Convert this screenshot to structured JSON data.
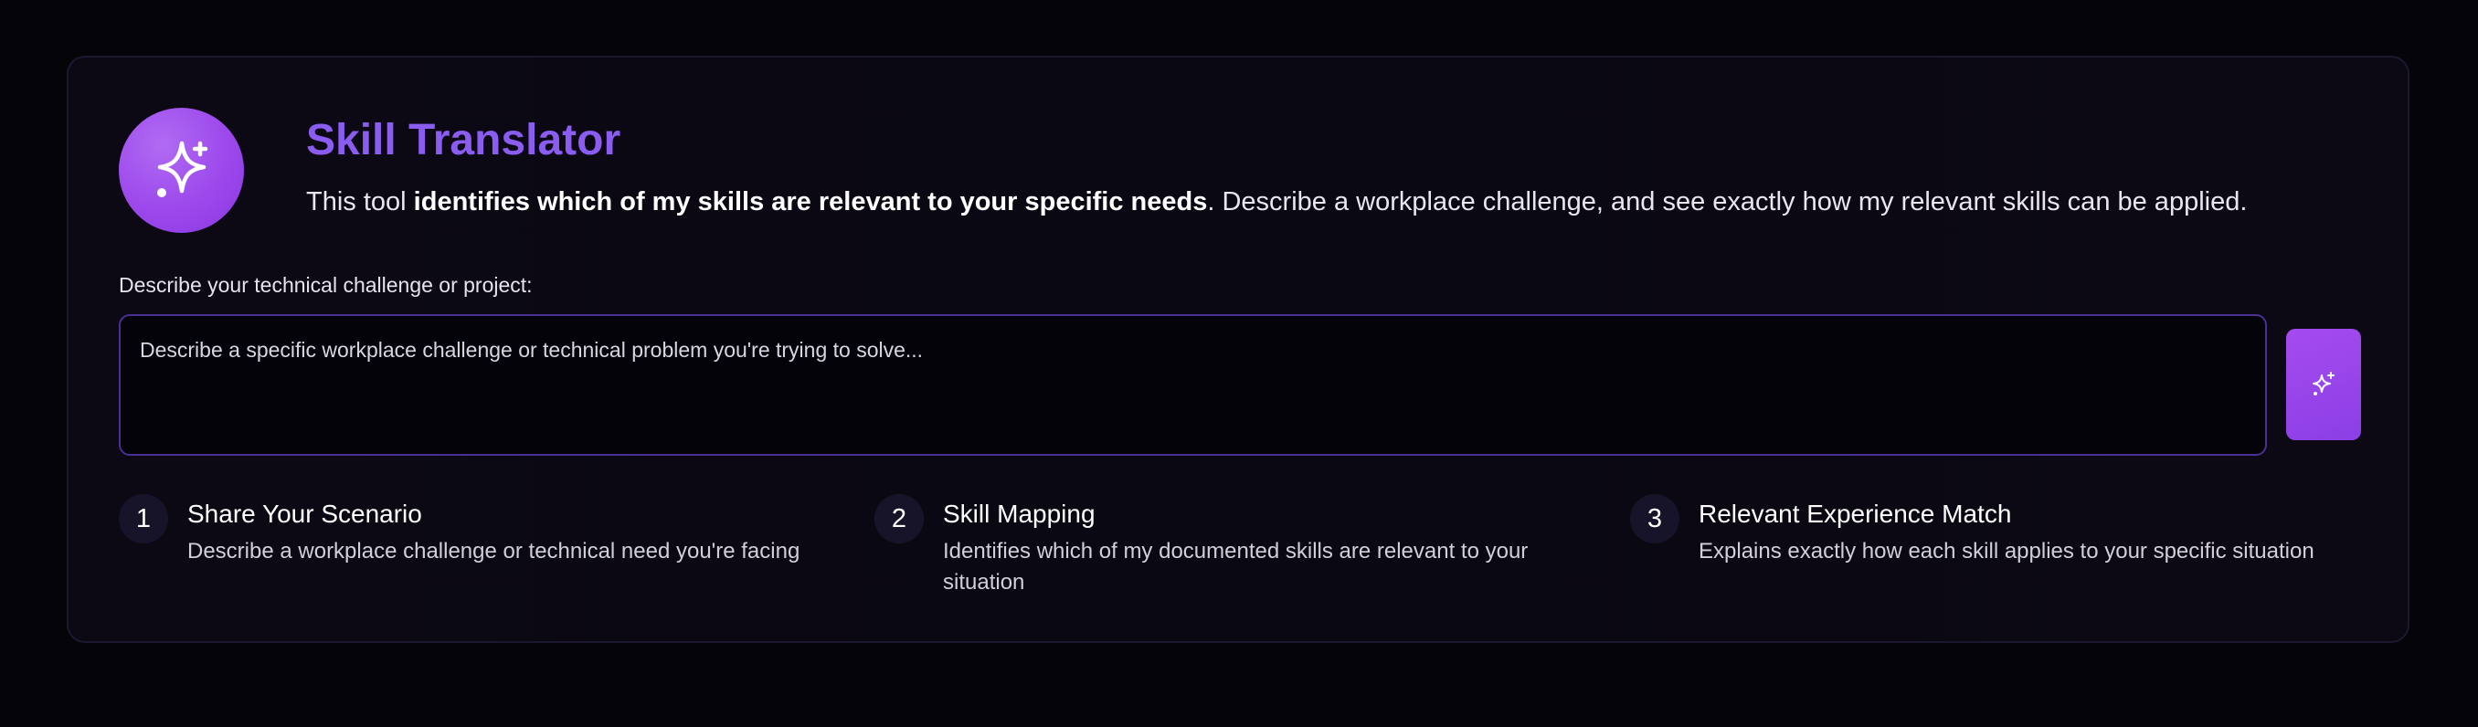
{
  "header": {
    "title": "Skill Translator",
    "description_prefix": "This tool ",
    "description_bold": "identifies which of my skills are relevant to your specific needs",
    "description_suffix": ". Describe a workplace challenge, and see exactly how my relevant skills can be applied.",
    "logo_icon": "sparkles-icon"
  },
  "form": {
    "label": "Describe your technical challenge or project:",
    "placeholder": "Describe a specific workplace challenge or technical problem you're trying to solve...",
    "value": "",
    "submit_icon": "sparkles-icon"
  },
  "steps": [
    {
      "number": "1",
      "title": "Share Your Scenario",
      "description": "Describe a workplace challenge or technical need you're facing"
    },
    {
      "number": "2",
      "title": "Skill Mapping",
      "description": "Identifies which of my documented skills are relevant to your situation"
    },
    {
      "number": "3",
      "title": "Relevant Experience Match",
      "description": "Explains exactly how each skill applies to your specific situation"
    }
  ],
  "colors": {
    "accent": "#8a5cf0",
    "accent_gradient_start": "#a54bee",
    "accent_gradient_end": "#8b3fe6",
    "background": "#050409",
    "card": "#0b0813",
    "input_border": "#4a2f94"
  }
}
